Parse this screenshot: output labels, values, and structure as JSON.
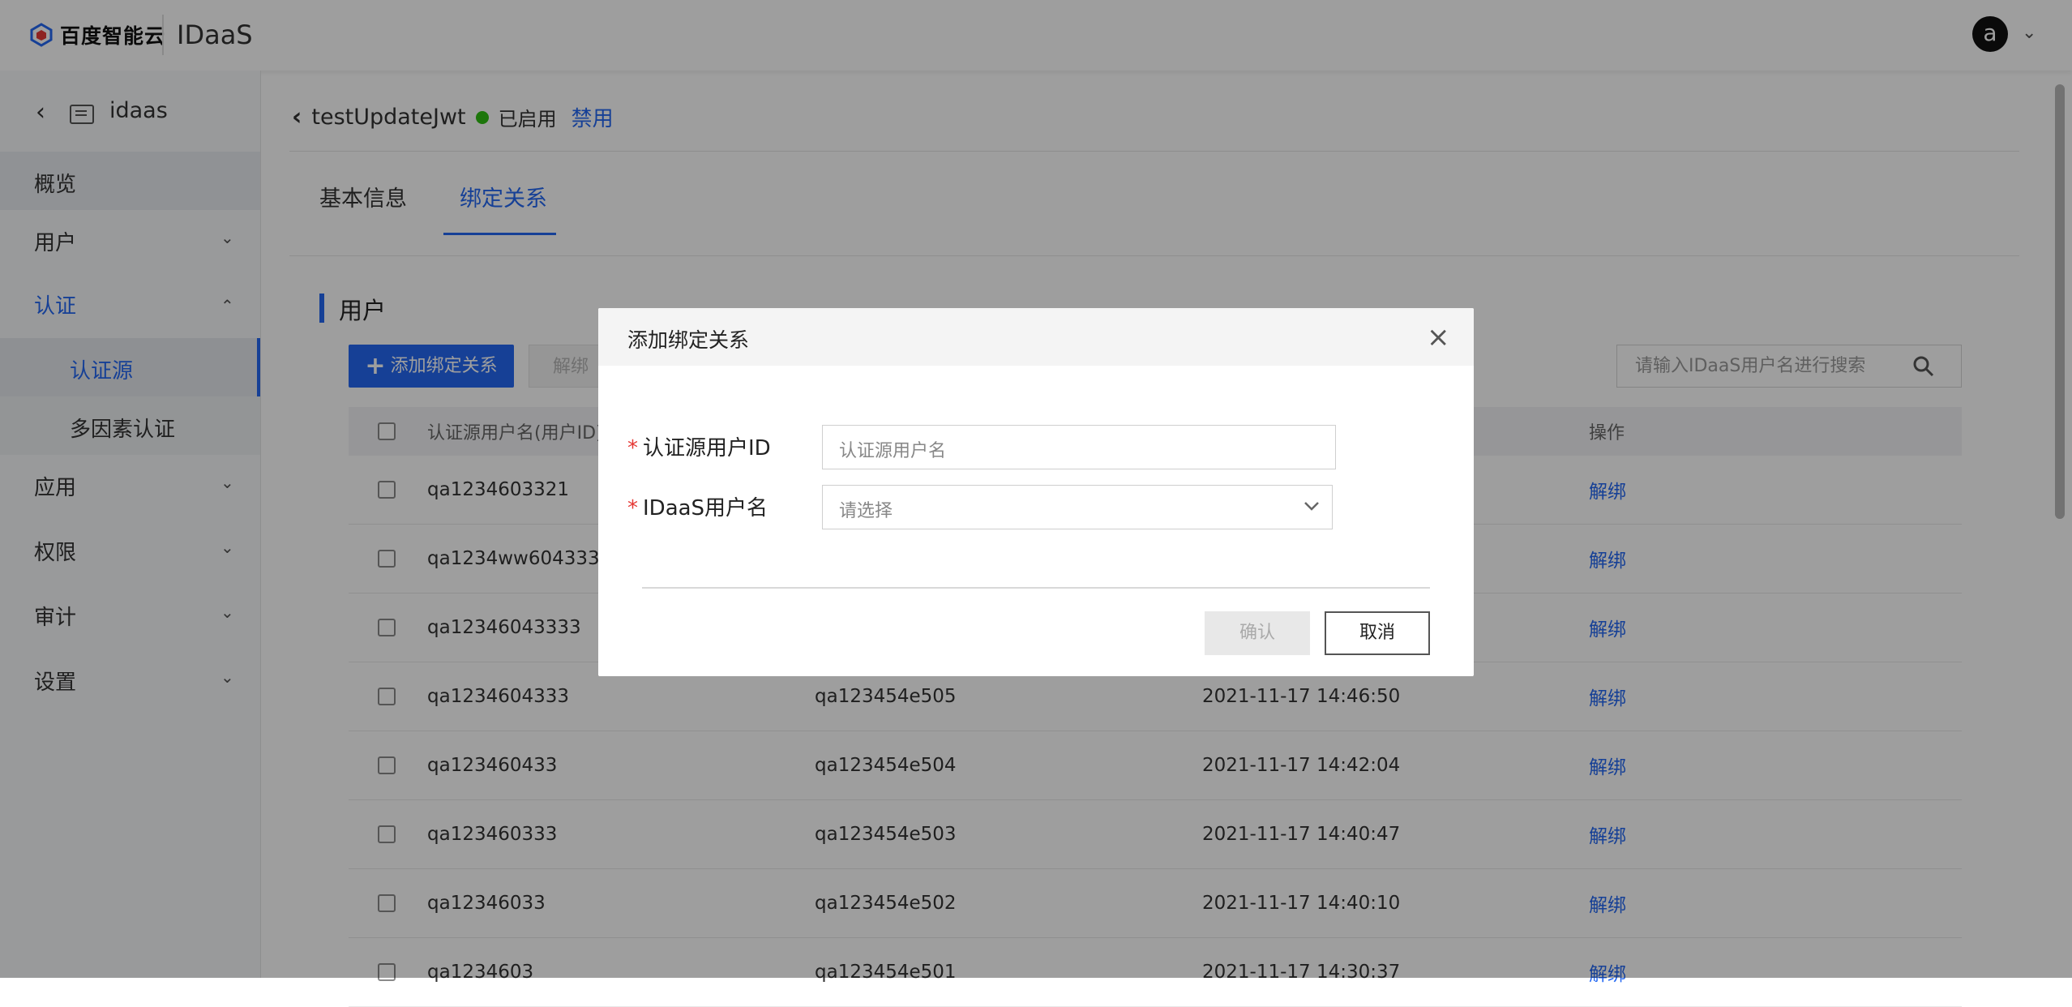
{
  "header": {
    "logo_text": "百度智能云",
    "product": "IDaaS",
    "avatar_letter": "a"
  },
  "sidebar": {
    "app_name": "idaas",
    "items": [
      {
        "label": "概览"
      },
      {
        "label": "用户"
      },
      {
        "label": "认证"
      },
      {
        "label": "认证源"
      },
      {
        "label": "多因素认证"
      },
      {
        "label": "应用"
      },
      {
        "label": "权限"
      },
      {
        "label": "审计"
      },
      {
        "label": "设置"
      }
    ]
  },
  "breadcrumb": {
    "name": "testUpdateJwt",
    "status": "已启用",
    "action": "禁用"
  },
  "tabs": [
    {
      "label": "基本信息"
    },
    {
      "label": "绑定关系"
    }
  ],
  "section": {
    "title": "用户",
    "add_button": "添加绑定关系",
    "unbind_button": "解绑",
    "search_placeholder": "请输入IDaaS用户名进行搜索"
  },
  "table": {
    "headers": [
      "认证源用户名(用户ID)",
      "",
      "",
      "操作"
    ],
    "rows": [
      {
        "source": "qa1234603321",
        "idaas": "",
        "time": "",
        "op": "解绑"
      },
      {
        "source": "qa1234ww6043333",
        "idaas": "",
        "time": "",
        "op": "解绑"
      },
      {
        "source": "qa12346043333",
        "idaas": "",
        "time": "",
        "op": "解绑"
      },
      {
        "source": "qa1234604333",
        "idaas": "qa123454e505",
        "time": "2021-11-17 14:46:50",
        "op": "解绑"
      },
      {
        "source": "qa123460433",
        "idaas": "qa123454e504",
        "time": "2021-11-17 14:42:04",
        "op": "解绑"
      },
      {
        "source": "qa123460333",
        "idaas": "qa123454e503",
        "time": "2021-11-17 14:40:47",
        "op": "解绑"
      },
      {
        "source": "qa12346033",
        "idaas": "qa123454e502",
        "time": "2021-11-17 14:40:10",
        "op": "解绑"
      },
      {
        "source": "qa1234603",
        "idaas": "qa123454e501",
        "time": "2021-11-17 14:30:37",
        "op": "解绑"
      }
    ]
  },
  "modal": {
    "title": "添加绑定关系",
    "required_mark": "*",
    "field1_label": "认证源用户ID",
    "field1_placeholder": "认证源用户名",
    "field2_label": "IDaaS用户名",
    "field2_placeholder": "请选择",
    "confirm": "确认",
    "cancel": "取消"
  }
}
